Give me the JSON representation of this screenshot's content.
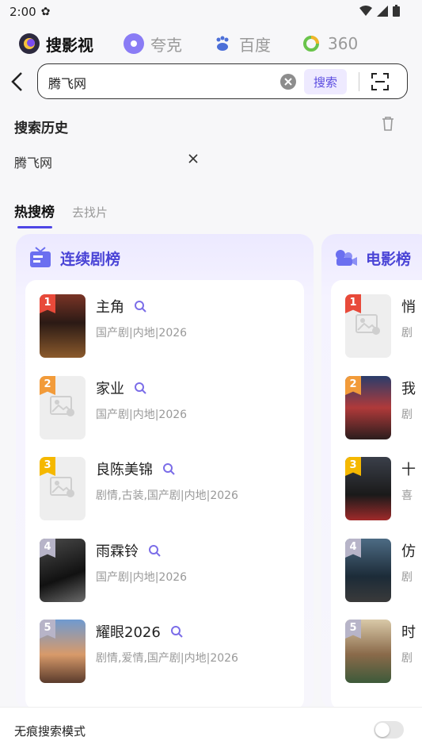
{
  "status_bar": {
    "time": "2:00"
  },
  "engines": [
    {
      "label": "搜影视",
      "active": true
    },
    {
      "label": "夸克",
      "active": false
    },
    {
      "label": "百度",
      "active": false
    },
    {
      "label": "360",
      "active": false
    }
  ],
  "search": {
    "value": "腾飞网",
    "button_label": "搜索"
  },
  "history": {
    "title": "搜索历史",
    "items": [
      "腾飞网"
    ]
  },
  "tabs": [
    {
      "label": "热搜榜",
      "active": true
    },
    {
      "label": "去找片",
      "active": false
    }
  ],
  "boards": [
    {
      "title": "连续剧榜",
      "items": [
        {
          "rank": "1",
          "title": "主角",
          "meta": "国产剧|内地|2026"
        },
        {
          "rank": "2",
          "title": "家业",
          "meta": "国产剧|内地|2026"
        },
        {
          "rank": "3",
          "title": "良陈美锦",
          "meta": "剧情,古装,国产剧|内地|2026"
        },
        {
          "rank": "4",
          "title": "雨霖铃",
          "meta": "国产剧|内地|2026"
        },
        {
          "rank": "5",
          "title": "耀眼2026",
          "meta": "剧情,爱情,国产剧|内地|2026"
        }
      ]
    },
    {
      "title": "电影榜",
      "items": [
        {
          "rank": "1",
          "title": "悄",
          "meta": "剧"
        },
        {
          "rank": "2",
          "title": "我",
          "meta": "剧"
        },
        {
          "rank": "3",
          "title": "十",
          "meta": "喜"
        },
        {
          "rank": "4",
          "title": "仿",
          "meta": "剧"
        },
        {
          "rank": "5",
          "title": "时",
          "meta": "剧"
        }
      ]
    }
  ],
  "bottom": {
    "label": "无痕搜索模式",
    "toggle_on": false
  },
  "colors": {
    "accent": "#4f46e5",
    "board_title": "#4a44d6",
    "search_button_bg": "#eeeaff"
  }
}
